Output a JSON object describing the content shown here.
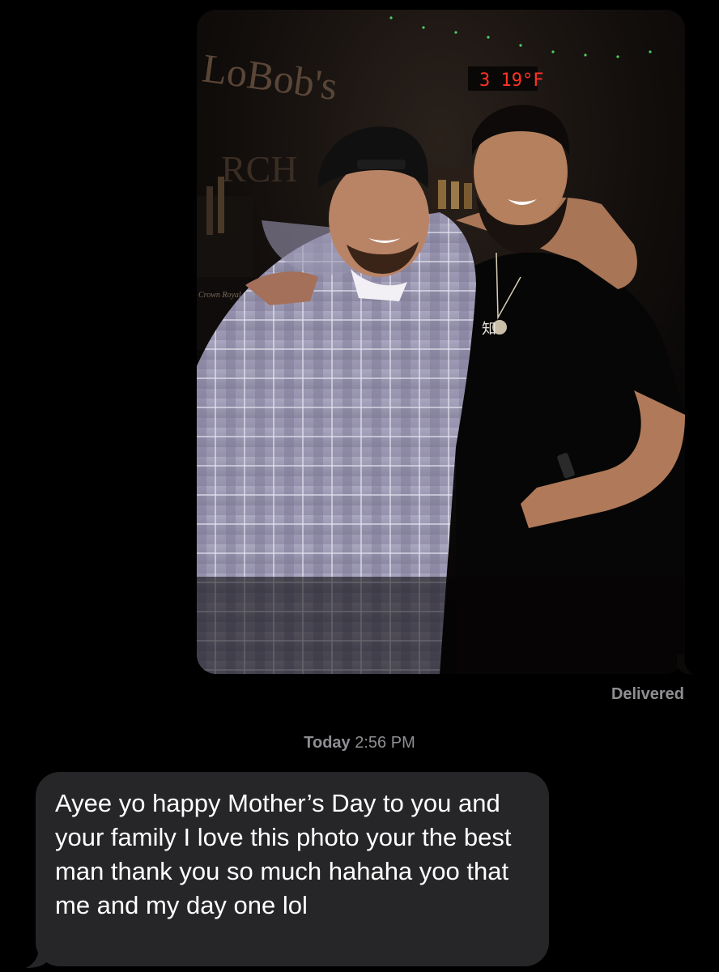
{
  "thread": {
    "photo_message": {
      "sign_text": "LoBob's",
      "sign_sub": "RCH",
      "clock_text": "3 19°F",
      "bottle_label": "Crown Royal",
      "necklace_glyph": "知"
    },
    "status": "Delivered",
    "timestamp": {
      "day": "Today",
      "time": "2:56 PM"
    },
    "incoming_message": {
      "text": "Ayee yo happy Mother’s Day to you and your family I love this photo your the best man thank you so much hahaha yoo that me and my day one lol"
    }
  },
  "colors": {
    "background": "#000000",
    "incoming_bubble": "#262628",
    "meta_text": "#8e8e93",
    "message_text": "#ffffff"
  }
}
